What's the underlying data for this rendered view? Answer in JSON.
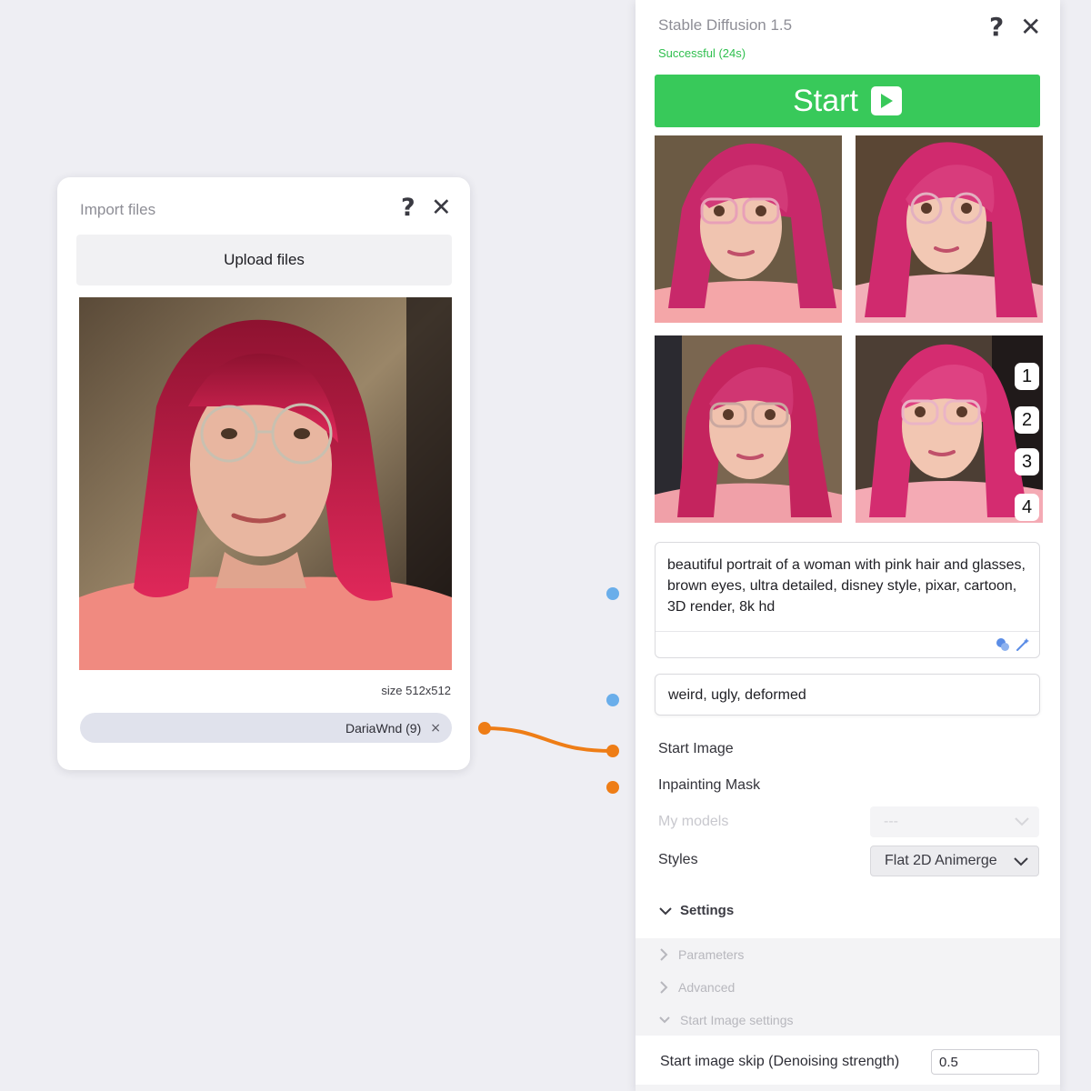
{
  "import_card": {
    "title": "Import files",
    "upload_label": "Upload files",
    "size_label": "size 512x512",
    "file_chip": {
      "name": "DariaWnd (9)",
      "remove_glyph": "×"
    },
    "help_glyph": "?",
    "close_glyph": "✕"
  },
  "sd_panel": {
    "title": "Stable Diffusion 1.5",
    "status": "Successful (24s)",
    "help_glyph": "?",
    "close_glyph": "✕",
    "start_label": "Start",
    "result_badges": [
      "1",
      "2",
      "3",
      "4"
    ],
    "prompt": "beautiful portrait of a woman with pink hair and glasses, brown eyes, ultra detailed, disney style, pixar, cartoon, 3D render, 8k hd",
    "negative_prompt": "weird, ugly, deformed",
    "inputs": {
      "start_image": "Start Image",
      "inpainting_mask": "Inpainting Mask"
    },
    "my_models": {
      "label": "My models",
      "value": "---"
    },
    "styles": {
      "label": "Styles",
      "value": "Flat 2D Animerge"
    },
    "settings": {
      "label": "Settings",
      "parameters": "Parameters",
      "advanced": "Advanced",
      "start_image_settings": "Start Image settings"
    },
    "denoise": {
      "label": "Start image skip (Denoising strength)",
      "value": "0.5"
    }
  },
  "colors": {
    "accent_green": "#38c95a",
    "status_green": "#2fbf4e",
    "port_blue": "#6aaeea",
    "port_orange": "#ee7d16",
    "chip_bg": "#e0e2ec"
  }
}
